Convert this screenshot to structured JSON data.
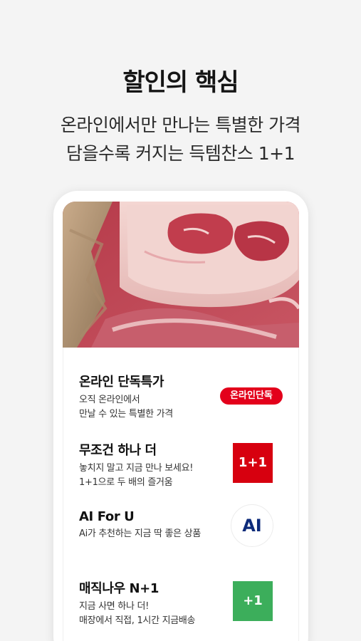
{
  "headline": "할인의 핵심",
  "subtitle_line1": "온라인에서만 만나는 특별한 가격",
  "subtitle_line2": "담을수록 커지는 득템찬스 1+1",
  "features": [
    {
      "title": "온라인 단독특가",
      "desc_line1": "오직 온라인에서",
      "desc_line2": "만날 수 있는 특별한 가격",
      "badge": "온라인단독",
      "badge_color": "#e3001b"
    },
    {
      "title": "무조건 하나 더",
      "desc_line1": "놓치지 말고 지금 만나 보세요!",
      "desc_line2": "1+1으로 두 배의 즐거움",
      "badge": "1+1",
      "badge_color": "#d7000f"
    },
    {
      "title": "AI For U",
      "desc_line1": "Ai가 추천하는 지금 딱 좋은 상품",
      "badge": "AI",
      "badge_color": "#0d2b7a"
    },
    {
      "title": "매직나우 N+1",
      "desc_line1": "지금 사면 하나 더!",
      "desc_line2": "매장에서 직접, 1시간 지금배송",
      "badge": "+1",
      "badge_color": "#3cae5b"
    }
  ],
  "hero_image": "raw-pork-meat-photo"
}
